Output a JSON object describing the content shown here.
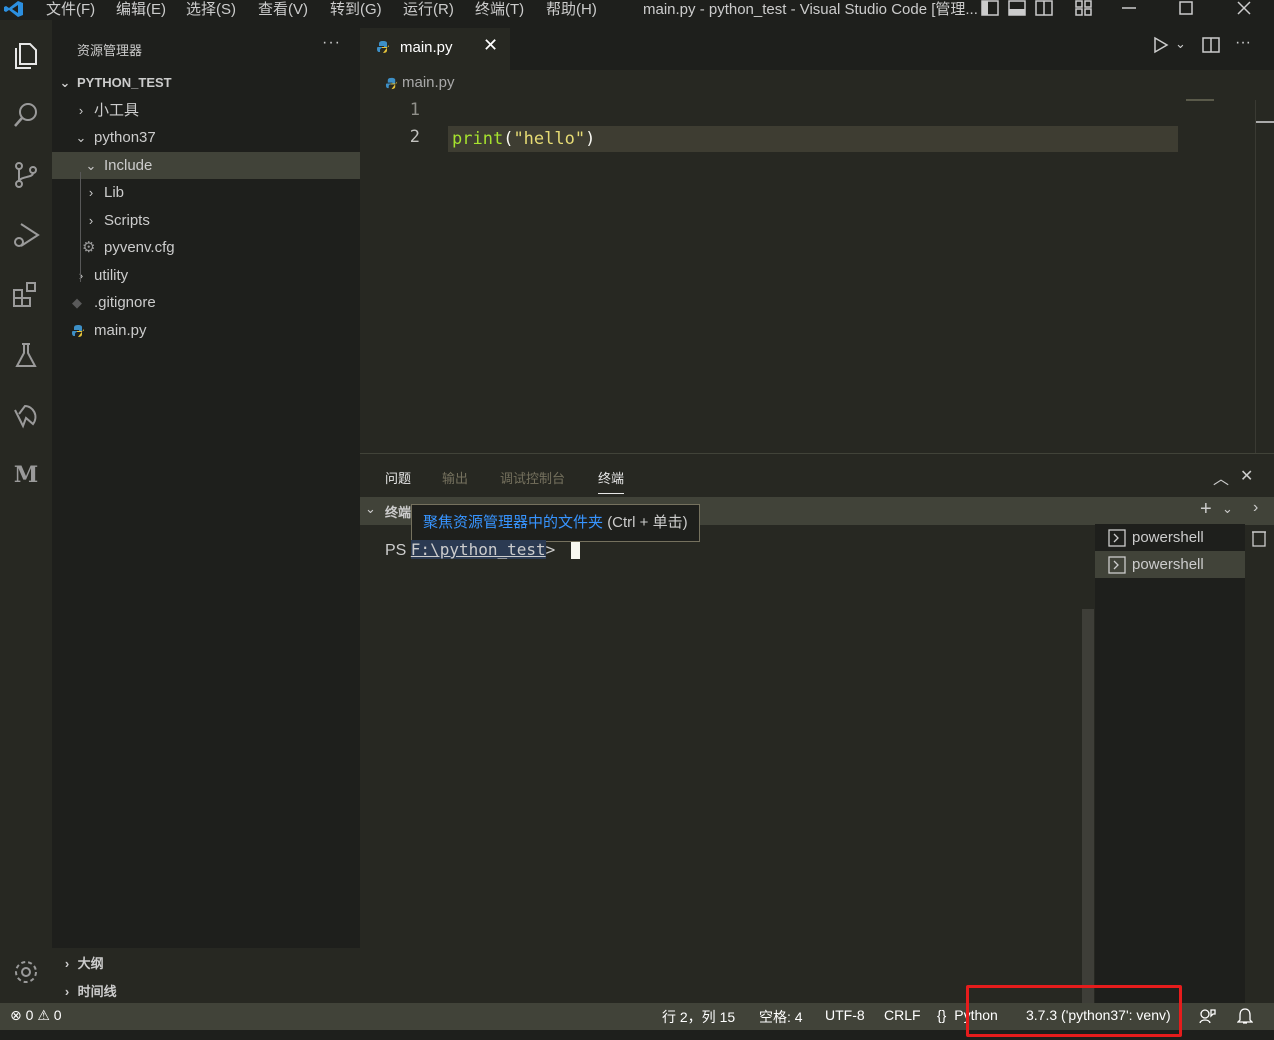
{
  "titlebar": {
    "menus": [
      "文件(F)",
      "编辑(E)",
      "选择(S)",
      "查看(V)",
      "转到(G)",
      "运行(R)",
      "终端(T)",
      "帮助(H)"
    ],
    "title": "main.py - python_test - Visual Studio Code [管理..."
  },
  "sidebar": {
    "title": "资源管理器",
    "more": "···",
    "root": "PYTHON_TEST",
    "items": [
      {
        "label": "小工具"
      },
      {
        "label": "python37"
      },
      {
        "label": "Include"
      },
      {
        "label": "Lib"
      },
      {
        "label": "Scripts"
      },
      {
        "label": "pyvenv.cfg"
      },
      {
        "label": "utility"
      },
      {
        "label": ".gitignore"
      },
      {
        "label": "main.py"
      }
    ],
    "outline": "大纲",
    "timeline": "时间线"
  },
  "editor": {
    "tab_label": "main.py",
    "breadcrumb": "main.py",
    "line_numbers": [
      "1",
      "2"
    ],
    "code": {
      "func": "print",
      "open": "(",
      "string": "\"hello\"",
      "close": ")"
    }
  },
  "panel": {
    "tabs": [
      "问题",
      "输出",
      "调试控制台",
      "终端"
    ],
    "terminal_header": "终端",
    "tooltip": {
      "link": "聚焦资源管理器中的文件夹",
      "shortcut": "(Ctrl + 单击)"
    },
    "prompt_ps": "PS ",
    "prompt_path": "F:\\python_test",
    "prompt_gt": ">",
    "terminals": [
      "powershell",
      "powershell"
    ]
  },
  "statusbar": {
    "errors": "0",
    "warnings": "0",
    "position": "行 2，列 15",
    "spaces": "空格: 4",
    "encoding": "UTF-8",
    "eol": "CRLF",
    "language": "Python",
    "interpreter": "3.7.3 ('python37': venv)"
  },
  "colors": {
    "accent_highlight": "#e61c1c",
    "code_func": "#a6e22e",
    "code_string": "#e6db74",
    "link": "#3794ff"
  }
}
